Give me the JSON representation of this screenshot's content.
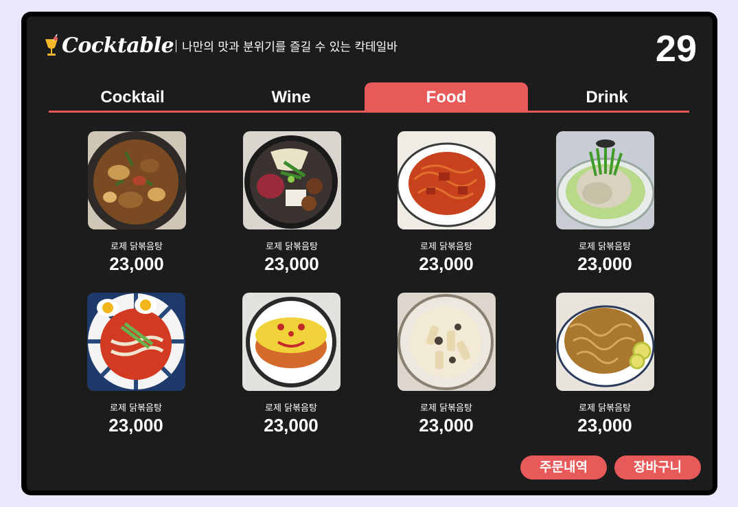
{
  "header": {
    "logo_text": "Cocktable",
    "tagline": "나만의 맛과 분위기를 즐길 수 있는 칵테일바",
    "table_number": "29"
  },
  "tabs": [
    {
      "label": "Cocktail",
      "active": false
    },
    {
      "label": "Wine",
      "active": false
    },
    {
      "label": "Food",
      "active": true
    },
    {
      "label": "Drink",
      "active": false
    }
  ],
  "menu_items": [
    {
      "name": "로제 닭볶음탕",
      "price": "23,000",
      "image": "braised-chicken-photo"
    },
    {
      "name": "로제 닭볶음탕",
      "price": "23,000",
      "image": "hotpot-photo"
    },
    {
      "name": "로제 닭볶음탕",
      "price": "23,000",
      "image": "spicy-pasta-photo"
    },
    {
      "name": "로제 닭볶음탕",
      "price": "23,000",
      "image": "chicken-soup-photo"
    },
    {
      "name": "로제 닭볶음탕",
      "price": "23,000",
      "image": "spicy-noodles-photo"
    },
    {
      "name": "로제 닭볶음탕",
      "price": "23,000",
      "image": "omurice-pasta-photo"
    },
    {
      "name": "로제 닭볶음탕",
      "price": "23,000",
      "image": "cream-pasta-photo"
    },
    {
      "name": "로제 닭볶음탕",
      "price": "23,000",
      "image": "fried-dish-photo"
    }
  ],
  "buttons": {
    "order_history": "주문내역",
    "cart": "장바구니"
  },
  "colors": {
    "accent": "#e85a5a",
    "screen_background": "#1c1c1c",
    "page_background": "#ebe6fb"
  }
}
